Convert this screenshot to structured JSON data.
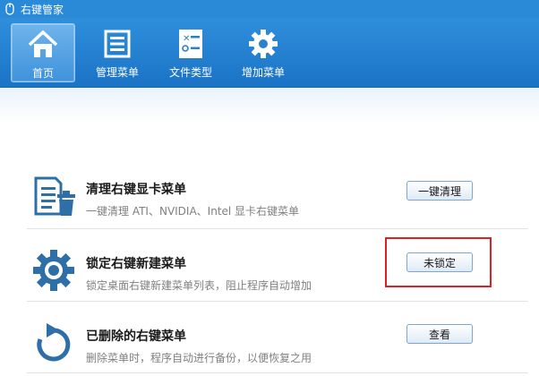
{
  "window": {
    "title": "右键管家"
  },
  "toolbar": {
    "items": [
      {
        "label": "首页",
        "icon": "home-icon",
        "active": true
      },
      {
        "label": "管理菜单",
        "icon": "menu-list-icon",
        "active": false
      },
      {
        "label": "文件类型",
        "icon": "file-types-icon",
        "active": false
      },
      {
        "label": "增加菜单",
        "icon": "gear-icon",
        "active": false
      }
    ]
  },
  "main": {
    "items": [
      {
        "title": "清理右键显卡菜单",
        "desc": "一键清理 ATI、NVIDIA、Intel 显卡右键菜单",
        "button": "一键清理",
        "icon": "clean-icon"
      },
      {
        "title": "锁定右键新建菜单",
        "desc": "锁定桌面右键新建菜单列表，阻止程序自动增加",
        "button": "未锁定",
        "icon": "gear-icon"
      },
      {
        "title": "已删除的右键菜单",
        "desc": "删除菜单时，程序自动进行备份，以便恢复之用",
        "button": "查看",
        "icon": "refresh-icon"
      }
    ]
  },
  "colors": {
    "accent": "#1f7dd0",
    "icon_blue": "#2f6fa8",
    "highlight": "#e02020"
  }
}
